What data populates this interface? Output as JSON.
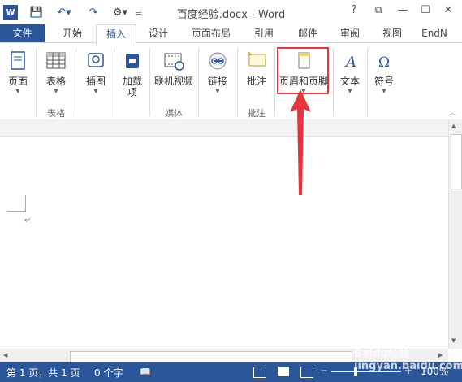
{
  "app": {
    "window_title": "百度经验.docx - Word",
    "help_glyph": "?",
    "restore_glyph": "⧉",
    "minimize_glyph": "—",
    "maximize_glyph": "☐",
    "close_glyph": "✕"
  },
  "tabs": [
    "文件",
    "开始",
    "插入",
    "设计",
    "页面布局",
    "引用",
    "邮件",
    "审阅",
    "视图",
    "EndN"
  ],
  "ribbon": {
    "buttons": [
      "页面",
      "表格",
      "插图",
      "加载\n项",
      "联机视频",
      "链接",
      "批注",
      "页眉和页脚",
      "文本",
      "符号"
    ],
    "groups": [
      "表格",
      "媒体",
      "批注"
    ]
  },
  "status": {
    "page": "第 1 页，共 1 页",
    "words": "0 个字",
    "zoom": "100%"
  },
  "watermark": "Baidu经验 jingyan.baidu.com",
  "colors": {
    "accent": "#2b579a",
    "highlight": "#e8333b"
  }
}
